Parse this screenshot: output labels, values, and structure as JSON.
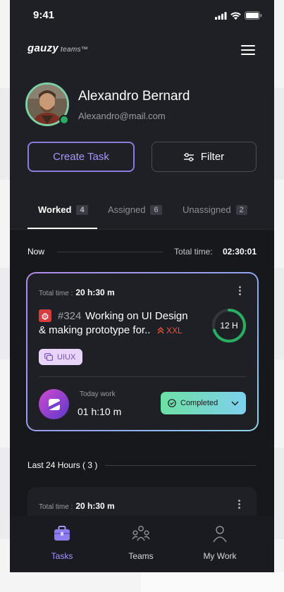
{
  "status_bar": {
    "time": "9:41"
  },
  "header": {
    "logo": "gauzy",
    "logo_sub": "teams™"
  },
  "profile": {
    "name": "Alexandro Bernard",
    "email": "Alexandro@mail.com"
  },
  "actions": {
    "create_task": "Create Task",
    "filter": "Filter"
  },
  "tabs": [
    {
      "label": "Worked",
      "count": "4"
    },
    {
      "label": "Assigned",
      "count": "6"
    },
    {
      "label": "Unassigned",
      "count": "2"
    }
  ],
  "now_section": {
    "label": "Now",
    "total_label": "Total time:",
    "total_value": "02:30:01"
  },
  "task_card": {
    "total_label": "Total time :",
    "total_value": "20 h:30 m",
    "task_number": "#324",
    "title_line1": "Working on UI Design",
    "title_line2": "& making prototype for..",
    "size": "XXL",
    "estimate": "12 H",
    "progress": 0.7,
    "label": "UIUX",
    "today_label": "Today work",
    "today_value": "01 h:10 m",
    "status": "Completed",
    "colors": {
      "bug": "#d63c3c",
      "size": "#e8533a",
      "ring": "#27ae60"
    }
  },
  "last24": {
    "label": "Last 24 Hours ( 3 )"
  },
  "task_card2": {
    "total_label": "Total time :",
    "total_value": "20 h:30 m"
  },
  "bottom_nav": [
    {
      "label": "Tasks",
      "icon": "briefcase-icon"
    },
    {
      "label": "Teams",
      "icon": "people-icon"
    },
    {
      "label": "My Work",
      "icon": "user-icon"
    }
  ]
}
